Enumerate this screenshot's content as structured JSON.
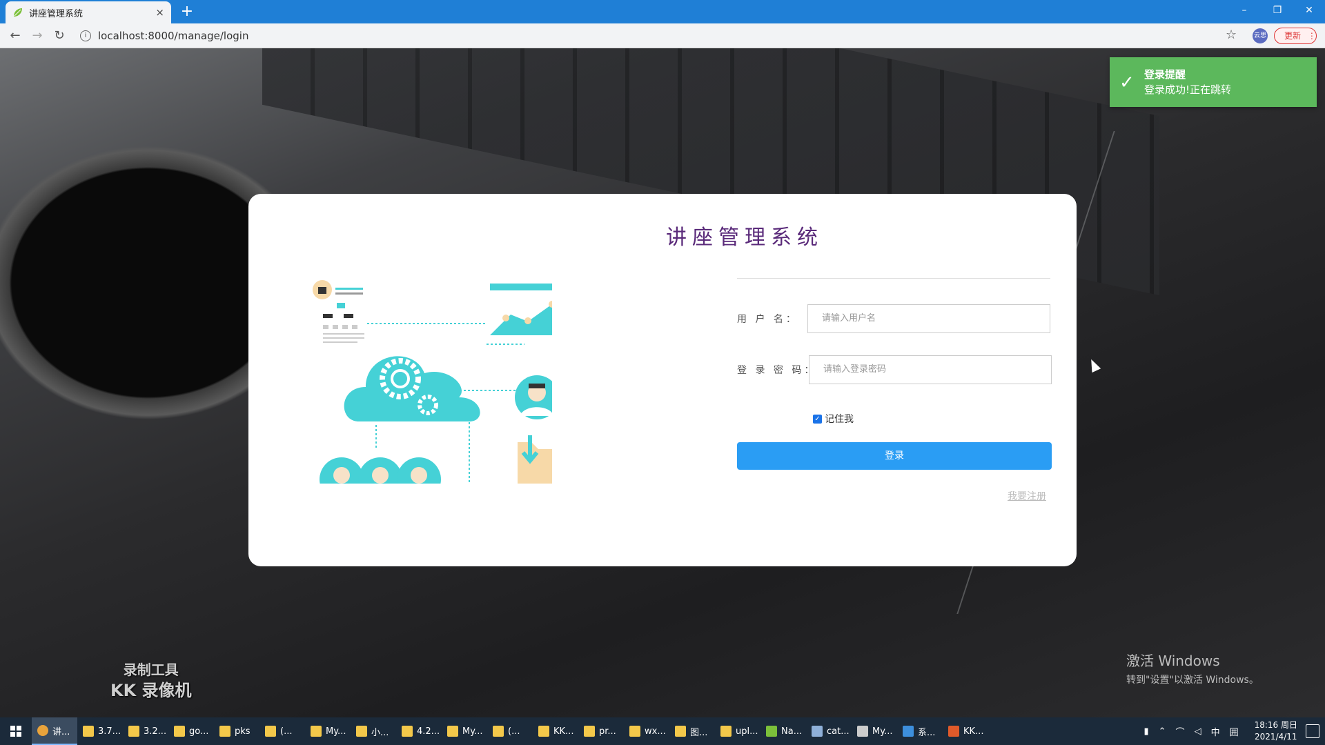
{
  "browser": {
    "tab_title": "讲座管理系统",
    "tab_close": "×",
    "new_tab": "+",
    "url": "localhost:8000/manage/login",
    "profile": "云思",
    "update_label": "更新",
    "window_controls": {
      "minimize": "–",
      "restore": "❐",
      "close": "✕"
    }
  },
  "login": {
    "system_title": "讲座管理系统",
    "username_label": "用 户 名：",
    "username_placeholder": "请输入用户名",
    "password_label": "登 录 密 码：",
    "password_placeholder": "请输入登录密码",
    "remember_label": "记住我",
    "remember_checked": true,
    "submit_label": "登录",
    "register_link": "我要注册"
  },
  "toast": {
    "title": "登录提醒",
    "message": "登录成功!正在跳转",
    "color": "#5cb85c"
  },
  "watermark": {
    "line1": "录制工具",
    "line2": "KK 录像机"
  },
  "activation": {
    "line1": "激活 Windows",
    "line2": "转到\"设置\"以激活 Windows。"
  },
  "taskbar": {
    "items": [
      {
        "label": "讲...",
        "icon": "chrome-icon",
        "active": true
      },
      {
        "label": "3.7...",
        "icon": "folder-icon"
      },
      {
        "label": "3.2...",
        "icon": "folder-icon"
      },
      {
        "label": "go...",
        "icon": "folder-icon"
      },
      {
        "label": "pks",
        "icon": "folder-icon"
      },
      {
        "label": "(...",
        "icon": "folder-icon"
      },
      {
        "label": "My...",
        "icon": "folder-icon"
      },
      {
        "label": "小...",
        "icon": "folder-icon"
      },
      {
        "label": "4.2...",
        "icon": "folder-icon"
      },
      {
        "label": "My...",
        "icon": "folder-icon"
      },
      {
        "label": "(...",
        "icon": "folder-icon"
      },
      {
        "label": "KK...",
        "icon": "folder-icon"
      },
      {
        "label": "pr...",
        "icon": "folder-icon"
      },
      {
        "label": "wx...",
        "icon": "folder-icon"
      },
      {
        "label": "图...",
        "icon": "folder-icon"
      },
      {
        "label": "upl...",
        "icon": "folder-icon"
      },
      {
        "label": "Na...",
        "icon": "leaf-icon"
      },
      {
        "label": "cat...",
        "icon": "app-icon"
      },
      {
        "label": "My...",
        "icon": "pen-icon"
      },
      {
        "label": "系...",
        "icon": "vs-icon"
      },
      {
        "label": "KK...",
        "icon": "kk-icon"
      }
    ],
    "tray": {
      "ime": "中",
      "grid": "囲"
    },
    "clock_time": "18:16 周日",
    "clock_date": "2021/4/11"
  },
  "colors": {
    "accent": "#2a9df4",
    "title": "#5a2a7a",
    "illustration": "#45d1d6"
  }
}
